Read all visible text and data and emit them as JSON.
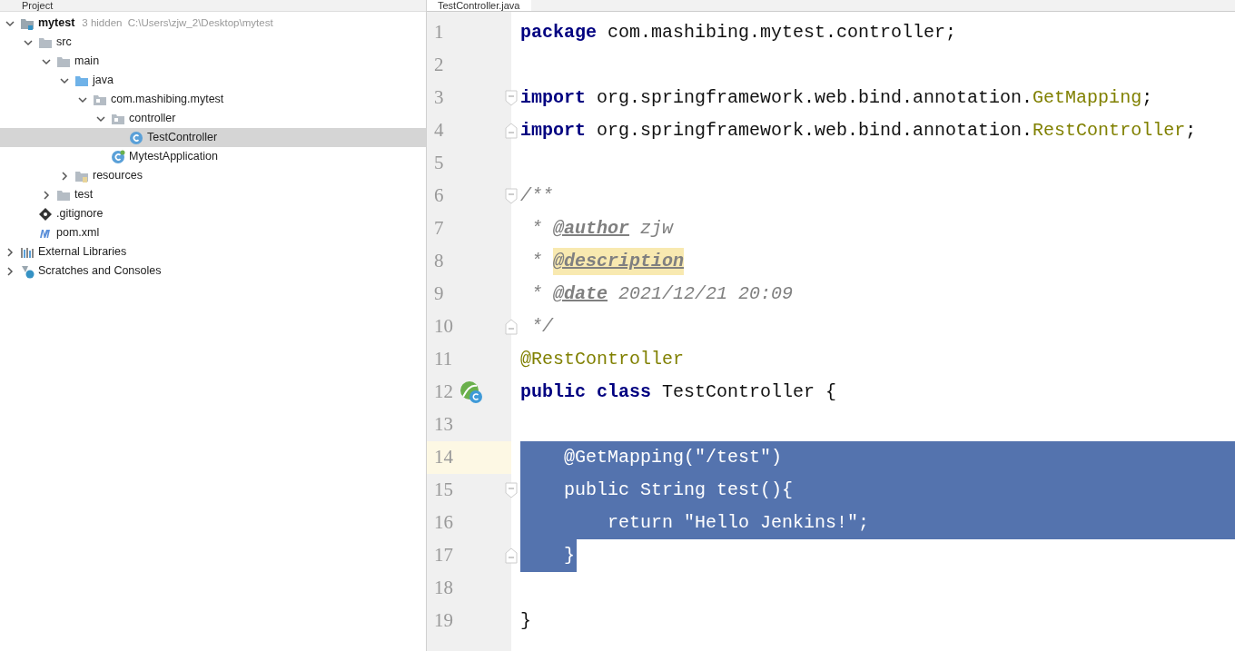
{
  "project_panel": {
    "title": "Project"
  },
  "tree": [
    {
      "name": "mytest",
      "kind": "module",
      "expanded": true,
      "selected": false,
      "hint": "3 hidden  C:\\Users\\zjw_2\\Desktop\\mytest",
      "children": [
        {
          "name": "src",
          "kind": "folder",
          "expanded": true,
          "selected": false,
          "children": [
            {
              "name": "main",
              "kind": "folder",
              "expanded": true,
              "selected": false,
              "children": [
                {
                  "name": "java",
                  "kind": "sourcefolder",
                  "expanded": true,
                  "selected": false,
                  "children": [
                    {
                      "name": "com.mashibing.mytest",
                      "kind": "package",
                      "expanded": true,
                      "selected": false,
                      "children": [
                        {
                          "name": "controller",
                          "kind": "package",
                          "expanded": true,
                          "selected": false,
                          "children": [
                            {
                              "name": "TestController",
                              "kind": "class",
                              "selected": true
                            }
                          ]
                        },
                        {
                          "name": "MytestApplication",
                          "kind": "springclass",
                          "selected": false
                        }
                      ]
                    }
                  ]
                },
                {
                  "name": "resources",
                  "kind": "resources",
                  "expanded": false,
                  "selected": false
                }
              ]
            },
            {
              "name": "test",
              "kind": "folder",
              "expanded": false,
              "selected": false
            }
          ]
        },
        {
          "name": ".gitignore",
          "kind": "git",
          "selected": false
        },
        {
          "name": "pom.xml",
          "kind": "maven",
          "selected": false
        }
      ]
    },
    {
      "name": "External Libraries",
      "kind": "libraries",
      "expanded": false,
      "selected": false
    },
    {
      "name": "Scratches and Consoles",
      "kind": "scratches",
      "expanded": false,
      "selected": false
    }
  ],
  "editor_tab": {
    "title": "TestController.java"
  },
  "code_lines": [
    {
      "number": "1",
      "tokens": [
        {
          "kind": "keyword",
          "text": "package"
        },
        {
          "kind": "plain",
          "text": " com.mashibing.mytest.controller;"
        }
      ]
    },
    {
      "number": "2"
    },
    {
      "number": "3",
      "fold_start": true,
      "tokens": [
        {
          "kind": "keyword",
          "text": "import"
        },
        {
          "kind": "plain",
          "text": " org.springframework.web.bind.annotation."
        },
        {
          "kind": "annotation",
          "text": "GetMapping"
        },
        {
          "kind": "plain",
          "text": ";"
        }
      ]
    },
    {
      "number": "4",
      "fold_end": true,
      "tokens": [
        {
          "kind": "keyword",
          "text": "import"
        },
        {
          "kind": "plain",
          "text": " org.springframework.web.bind.annotation."
        },
        {
          "kind": "annotation",
          "text": "RestController"
        },
        {
          "kind": "plain",
          "text": ";"
        }
      ]
    },
    {
      "number": "5"
    },
    {
      "number": "6",
      "fold_start": true,
      "tokens": [
        {
          "kind": "comment",
          "text": "/**"
        }
      ]
    },
    {
      "number": "7",
      "tokens": [
        {
          "kind": "comment",
          "text": " * "
        },
        {
          "kind": "doctag",
          "text": "@author"
        },
        {
          "kind": "comment",
          "text": " zjw"
        }
      ]
    },
    {
      "number": "8",
      "tokens": [
        {
          "kind": "comment",
          "text": " * "
        },
        {
          "kind": "doctag",
          "highlighted": true,
          "text": "@description"
        }
      ]
    },
    {
      "number": "9",
      "tokens": [
        {
          "kind": "comment",
          "text": " * "
        },
        {
          "kind": "doctag",
          "text": "@date"
        },
        {
          "kind": "comment",
          "text": " 2021/12/21 20:09"
        }
      ]
    },
    {
      "number": "10",
      "fold_end": true,
      "tokens": [
        {
          "kind": "comment",
          "text": " */"
        }
      ]
    },
    {
      "number": "11",
      "tokens": [
        {
          "kind": "annotation",
          "text": "@RestController"
        }
      ]
    },
    {
      "number": "12",
      "gutter_icon": true,
      "tokens": [
        {
          "kind": "keyword",
          "text": "public class"
        },
        {
          "kind": "plain",
          "text": " TestController {"
        }
      ]
    },
    {
      "number": "13"
    },
    {
      "number": "14",
      "current": true,
      "selected": true,
      "tokens": [
        {
          "kind": "plain",
          "text": "    @GetMapping(\"/test\")"
        }
      ]
    },
    {
      "number": "15",
      "fold_start": true,
      "selected": true,
      "tokens": [
        {
          "kind": "plain",
          "text": "    public "
        },
        {
          "kind": "type",
          "text": "String test(){"
        }
      ]
    },
    {
      "number": "16",
      "selected": true,
      "tokens": [
        {
          "kind": "plain",
          "text": "        return \"Hello Jenkins!\";"
        }
      ]
    },
    {
      "number": "17",
      "fold_end": true,
      "selected": true,
      "tokens": [
        {
          "kind": "plain",
          "text": "    }"
        }
      ]
    },
    {
      "number": "18"
    },
    {
      "number": "19",
      "tokens": [
        {
          "kind": "plain",
          "text": "}"
        }
      ]
    }
  ]
}
